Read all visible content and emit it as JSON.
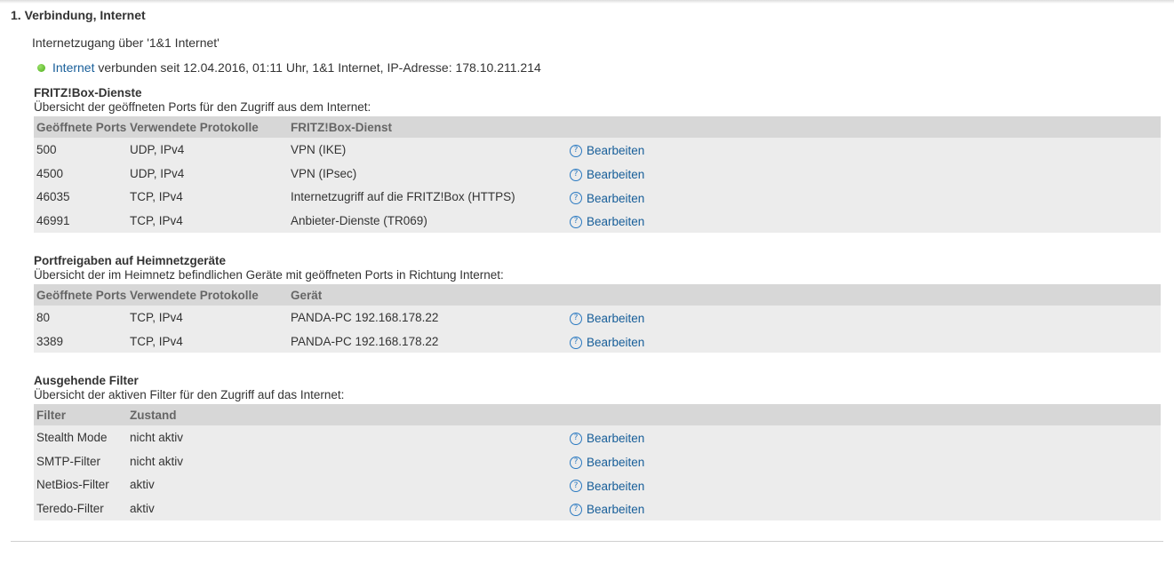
{
  "section": {
    "title": "1. Verbindung, Internet",
    "access": "Internetzugang über '1&1 Internet'",
    "status": {
      "link": "Internet",
      "text": " verbunden seit 12.04.2016, 01:11 Uhr, 1&1 Internet, IP-Adresse: 178.10.211.214",
      "dot_color": "#4caf1a"
    }
  },
  "services": {
    "title": "FRITZ!Box-Dienste",
    "desc": "Übersicht der geöffneten Ports für den Zugriff aus dem Internet:",
    "headers": [
      "Geöffnete Ports",
      "Verwendete Protokolle",
      "FRITZ!Box-Dienst"
    ],
    "rows": [
      {
        "port": "500",
        "proto": "UDP, IPv4",
        "service": "VPN (IKE)",
        "action": "Bearbeiten"
      },
      {
        "port": "4500",
        "proto": "UDP, IPv4",
        "service": "VPN (IPsec)",
        "action": "Bearbeiten"
      },
      {
        "port": "46035",
        "proto": "TCP, IPv4",
        "service": "Internetzugriff auf die FRITZ!Box (HTTPS)",
        "action": "Bearbeiten"
      },
      {
        "port": "46991",
        "proto": "TCP, IPv4",
        "service": "Anbieter-Dienste (TR069)",
        "action": "Bearbeiten"
      }
    ]
  },
  "forwards": {
    "title": "Portfreigaben auf Heimnetzgeräte",
    "desc": "Übersicht der im Heimnetz befindlichen Geräte mit geöffneten Ports in Richtung Internet:",
    "headers": [
      "Geöffnete Ports",
      "Verwendete Protokolle",
      "Gerät"
    ],
    "rows": [
      {
        "port": "80",
        "proto": "TCP, IPv4",
        "device": "PANDA-PC 192.168.178.22",
        "action": "Bearbeiten"
      },
      {
        "port": "3389",
        "proto": "TCP, IPv4",
        "device": "PANDA-PC 192.168.178.22",
        "action": "Bearbeiten"
      }
    ]
  },
  "filters": {
    "title": "Ausgehende Filter",
    "desc": "Übersicht der aktiven Filter für den Zugriff auf das Internet:",
    "headers": [
      "Filter",
      "Zustand"
    ],
    "rows": [
      {
        "name": "Stealth Mode",
        "state": "nicht aktiv",
        "action": "Bearbeiten"
      },
      {
        "name": "SMTP-Filter",
        "state": "nicht aktiv",
        "action": "Bearbeiten"
      },
      {
        "name": "NetBios-Filter",
        "state": "aktiv",
        "action": "Bearbeiten"
      },
      {
        "name": "Teredo-Filter",
        "state": "aktiv",
        "action": "Bearbeiten"
      }
    ]
  },
  "icons": {
    "help": "help-icon",
    "status": "status-dot"
  }
}
